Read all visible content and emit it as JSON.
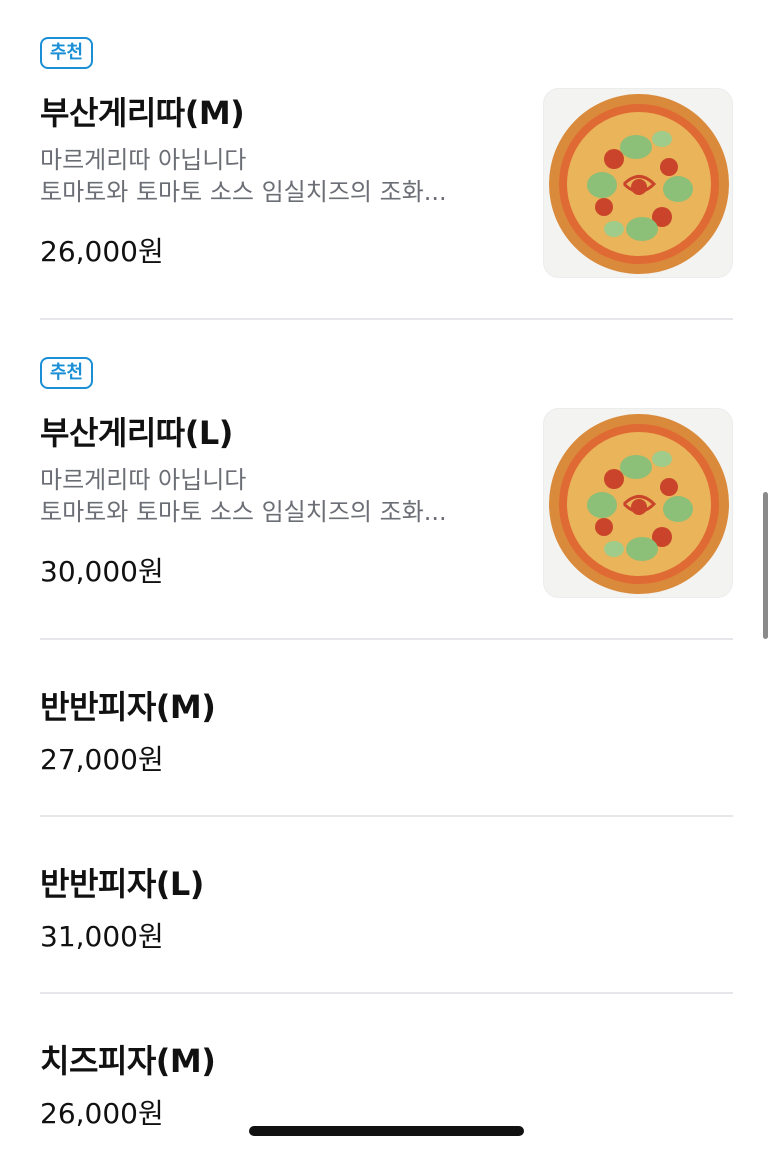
{
  "menu": {
    "items": [
      {
        "badge": "추천",
        "name": "부산게리따(M)",
        "desc_line1": "마르게리따 아닙니다",
        "desc_line2": "토마토와 토마토 소스 임실치즈의 조화...",
        "price": "26,000원",
        "image": "pizza-photo"
      },
      {
        "badge": "추천",
        "name": "부산게리따(L)",
        "desc_line1": "마르게리따 아닙니다",
        "desc_line2": "토마토와 토마토 소스 임실치즈의 조화...",
        "price": "30,000원",
        "image": "pizza-photo"
      },
      {
        "name": "반반피자(M)",
        "price": "27,000원"
      },
      {
        "name": "반반피자(L)",
        "price": "31,000원"
      },
      {
        "name": "치즈피자(M)",
        "price": "26,000원"
      }
    ]
  },
  "colors": {
    "badge": "#1a8fd6",
    "description": "#6b6e75",
    "divider": "#e6e7ea"
  }
}
